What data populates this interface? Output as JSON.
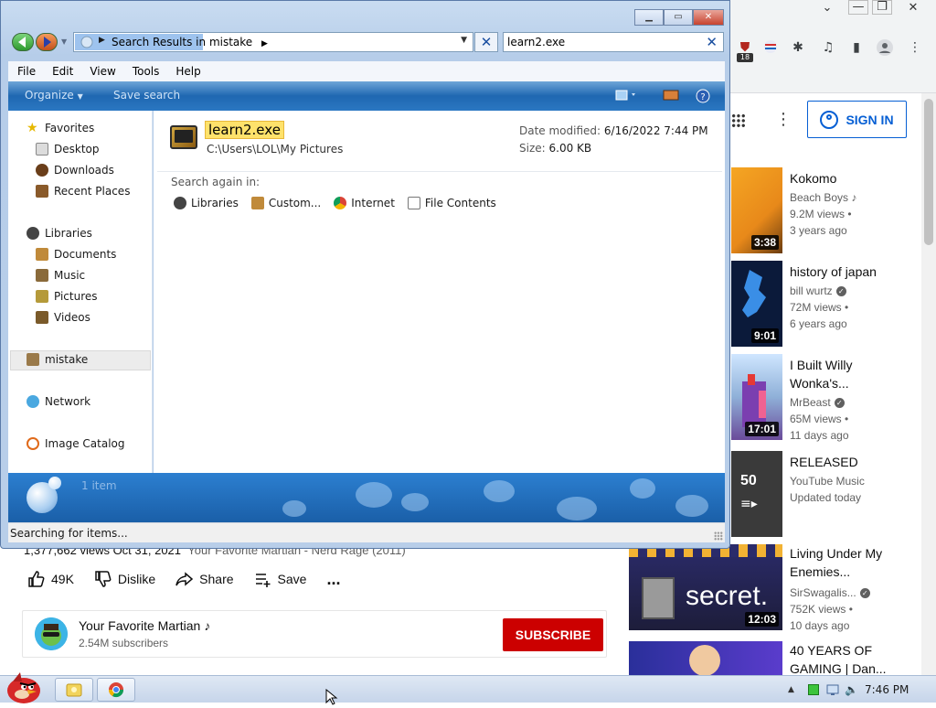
{
  "browser": {
    "signin_label": "SIGN IN",
    "extension_badge": "18",
    "recommendations": [
      {
        "title": "Kokomo",
        "channel": "Beach Boys",
        "views": "9.2M views",
        "age": "3 years ago",
        "duration": "3:38",
        "note_icon": "music-note-icon"
      },
      {
        "title": "history of japan",
        "channel": "bill wurtz",
        "views": "72M views",
        "age": "6 years ago",
        "duration": "9:01"
      },
      {
        "title": "I Built Willy Wonka's...",
        "channel": "MrBeast",
        "views": "65M views",
        "age": "11 days ago",
        "duration": "17:01"
      },
      {
        "title": "RELEASED",
        "channel": "YouTube Music",
        "views": "Updated today",
        "age": "",
        "duration": "50"
      },
      {
        "title": "Living Under My Enemies...",
        "channel": "SirSwagalis...",
        "views": "752K views",
        "age": "10 days ago",
        "duration": "12:03",
        "thumb_text": "secret."
      },
      {
        "title": "40 YEARS OF GAMING | Dan...",
        "channel": "",
        "views": "",
        "age": "",
        "duration": ""
      }
    ],
    "video": {
      "views_line": "1,377,662 views  Oct 31, 2021",
      "hashtag_line": "Your Favorite Martian - Nerd Rage (2011)",
      "likes": "49K",
      "dislike_label": "Dislike",
      "share_label": "Share",
      "save_label": "Save",
      "more_label": "..."
    },
    "channel": {
      "name": "Your Favorite Martian",
      "subscribers": "2.54M subscribers",
      "subscribe_label": "SUBSCRIBE"
    }
  },
  "explorer": {
    "address": {
      "prefix": "Search Results in",
      "location": "mistake"
    },
    "search_value": "learn2.exe",
    "menu": [
      "File",
      "Edit",
      "View",
      "Tools",
      "Help"
    ],
    "commands": {
      "organize": "Organize",
      "save_search": "Save search"
    },
    "nav": {
      "favorites": "Favorites",
      "favorites_items": [
        "Desktop",
        "Downloads",
        "Recent Places"
      ],
      "libraries": "Libraries",
      "libraries_items": [
        "Documents",
        "Music",
        "Pictures",
        "Videos"
      ],
      "selected": "mistake",
      "network": "Network",
      "image_catalog": "Image Catalog"
    },
    "result": {
      "name": "learn2.exe",
      "path": "C:\\Users\\LOL\\My Pictures",
      "date_label": "Date modified:",
      "date_value": "6/16/2022 7:44 PM",
      "size_label": "Size:",
      "size_value": "6.00 KB"
    },
    "search_again": {
      "label": "Search again in:",
      "options": [
        "Libraries",
        "Custom...",
        "Internet",
        "File Contents"
      ]
    },
    "details_count": "1 item",
    "status": "Searching for items..."
  },
  "taskbar": {
    "time": "7:46 PM"
  },
  "colors": {
    "youtube_red": "#cc0000",
    "link_blue": "#065fd4",
    "explorer_blue": "#1f67b1",
    "highlight_yellow": "#ffe26b"
  }
}
